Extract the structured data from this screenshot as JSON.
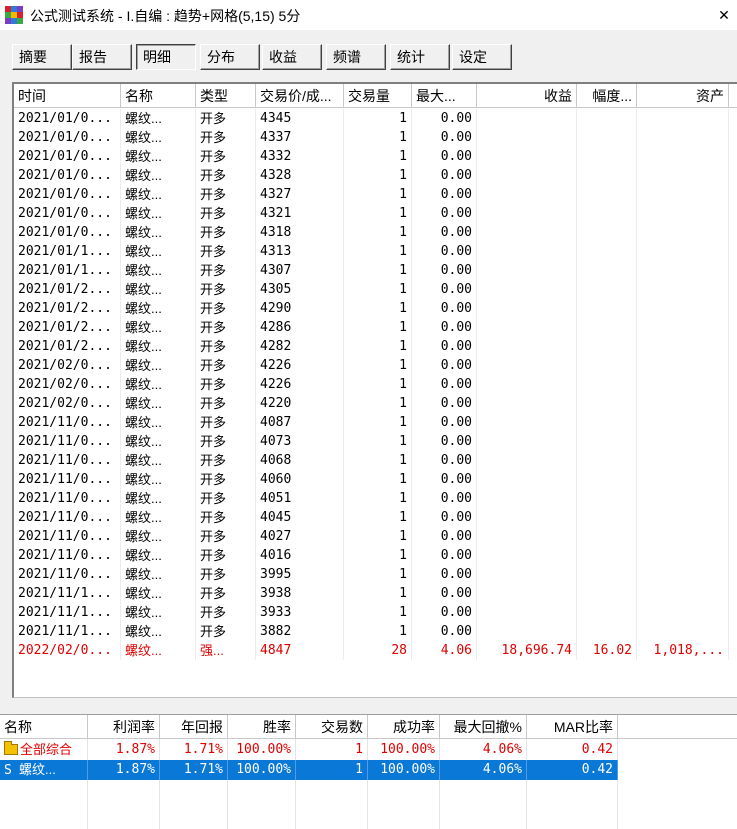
{
  "window": {
    "title": "公式测试系统 - I.自编 : 趋势+网格(5,15) 5分",
    "close_glyph": "✕",
    "icon_colors": [
      "#d6222a",
      "#2e7bd8",
      "#7a3fc0",
      "#3aa845",
      "#f2b900",
      "#d6222a",
      "#7a3fc0",
      "#2e7bd8",
      "#3aa845"
    ]
  },
  "tabs": [
    {
      "label": "摘要",
      "active": false
    },
    {
      "label": "报告",
      "active": false
    },
    {
      "label": "明细",
      "active": true
    },
    {
      "label": "分布",
      "active": false
    },
    {
      "label": "收益",
      "active": false
    },
    {
      "label": "频谱",
      "active": false
    },
    {
      "label": "统计",
      "active": false
    },
    {
      "label": "设定",
      "active": false
    }
  ],
  "detail": {
    "columns": [
      "时间",
      "名称",
      "类型",
      "交易价/成...",
      "交易量",
      "最大...",
      "收益",
      "幅度...",
      "资产"
    ],
    "rows": [
      [
        "2021/01/0...",
        "螺纹...",
        "开多",
        "4345",
        "1",
        "0.00",
        "",
        "",
        ""
      ],
      [
        "2021/01/0...",
        "螺纹...",
        "开多",
        "4337",
        "1",
        "0.00",
        "",
        "",
        ""
      ],
      [
        "2021/01/0...",
        "螺纹...",
        "开多",
        "4332",
        "1",
        "0.00",
        "",
        "",
        ""
      ],
      [
        "2021/01/0...",
        "螺纹...",
        "开多",
        "4328",
        "1",
        "0.00",
        "",
        "",
        ""
      ],
      [
        "2021/01/0...",
        "螺纹...",
        "开多",
        "4327",
        "1",
        "0.00",
        "",
        "",
        ""
      ],
      [
        "2021/01/0...",
        "螺纹...",
        "开多",
        "4321",
        "1",
        "0.00",
        "",
        "",
        ""
      ],
      [
        "2021/01/0...",
        "螺纹...",
        "开多",
        "4318",
        "1",
        "0.00",
        "",
        "",
        ""
      ],
      [
        "2021/01/1...",
        "螺纹...",
        "开多",
        "4313",
        "1",
        "0.00",
        "",
        "",
        ""
      ],
      [
        "2021/01/1...",
        "螺纹...",
        "开多",
        "4307",
        "1",
        "0.00",
        "",
        "",
        ""
      ],
      [
        "2021/01/2...",
        "螺纹...",
        "开多",
        "4305",
        "1",
        "0.00",
        "",
        "",
        ""
      ],
      [
        "2021/01/2...",
        "螺纹...",
        "开多",
        "4290",
        "1",
        "0.00",
        "",
        "",
        ""
      ],
      [
        "2021/01/2...",
        "螺纹...",
        "开多",
        "4286",
        "1",
        "0.00",
        "",
        "",
        ""
      ],
      [
        "2021/01/2...",
        "螺纹...",
        "开多",
        "4282",
        "1",
        "0.00",
        "",
        "",
        ""
      ],
      [
        "2021/02/0...",
        "螺纹...",
        "开多",
        "4226",
        "1",
        "0.00",
        "",
        "",
        ""
      ],
      [
        "2021/02/0...",
        "螺纹...",
        "开多",
        "4226",
        "1",
        "0.00",
        "",
        "",
        ""
      ],
      [
        "2021/02/0...",
        "螺纹...",
        "开多",
        "4220",
        "1",
        "0.00",
        "",
        "",
        ""
      ],
      [
        "2021/11/0...",
        "螺纹...",
        "开多",
        "4087",
        "1",
        "0.00",
        "",
        "",
        ""
      ],
      [
        "2021/11/0...",
        "螺纹...",
        "开多",
        "4073",
        "1",
        "0.00",
        "",
        "",
        ""
      ],
      [
        "2021/11/0...",
        "螺纹...",
        "开多",
        "4068",
        "1",
        "0.00",
        "",
        "",
        ""
      ],
      [
        "2021/11/0...",
        "螺纹...",
        "开多",
        "4060",
        "1",
        "0.00",
        "",
        "",
        ""
      ],
      [
        "2021/11/0...",
        "螺纹...",
        "开多",
        "4051",
        "1",
        "0.00",
        "",
        "",
        ""
      ],
      [
        "2021/11/0...",
        "螺纹...",
        "开多",
        "4045",
        "1",
        "0.00",
        "",
        "",
        ""
      ],
      [
        "2021/11/0...",
        "螺纹...",
        "开多",
        "4027",
        "1",
        "0.00",
        "",
        "",
        ""
      ],
      [
        "2021/11/0...",
        "螺纹...",
        "开多",
        "4016",
        "1",
        "0.00",
        "",
        "",
        ""
      ],
      [
        "2021/11/0...",
        "螺纹...",
        "开多",
        "3995",
        "1",
        "0.00",
        "",
        "",
        ""
      ],
      [
        "2021/11/1...",
        "螺纹...",
        "开多",
        "3938",
        "1",
        "0.00",
        "",
        "",
        ""
      ],
      [
        "2021/11/1...",
        "螺纹...",
        "开多",
        "3933",
        "1",
        "0.00",
        "",
        "",
        ""
      ],
      [
        "2021/11/1...",
        "螺纹...",
        "开多",
        "3882",
        "1",
        "0.00",
        "",
        "",
        ""
      ]
    ],
    "total_row": [
      "2022/02/0...",
      "螺纹...",
      "强...",
      "4847",
      "28",
      "4.06",
      "18,696.74",
      "16.02",
      "1,018,..."
    ],
    "highlight_color": "#e00000"
  },
  "summary": {
    "columns": [
      "名称",
      "利润率",
      "年回报",
      "胜率",
      "交易数",
      "成功率",
      "最大回撤%",
      "MAR比率"
    ],
    "rows": [
      {
        "icon": "folder-icon",
        "glyph": "",
        "cells": [
          "全部综合",
          "1.87%",
          "1.71%",
          "100.00%",
          "1",
          "100.00%",
          "4.06%",
          "0.42"
        ],
        "style": "red"
      },
      {
        "icon": "s-icon",
        "glyph": "S",
        "cells": [
          "螺纹...",
          "1.87%",
          "1.71%",
          "100.00%",
          "1",
          "100.00%",
          "4.06%",
          "0.42"
        ],
        "style": "selected"
      }
    ],
    "selection_color": "#0a78d7"
  }
}
